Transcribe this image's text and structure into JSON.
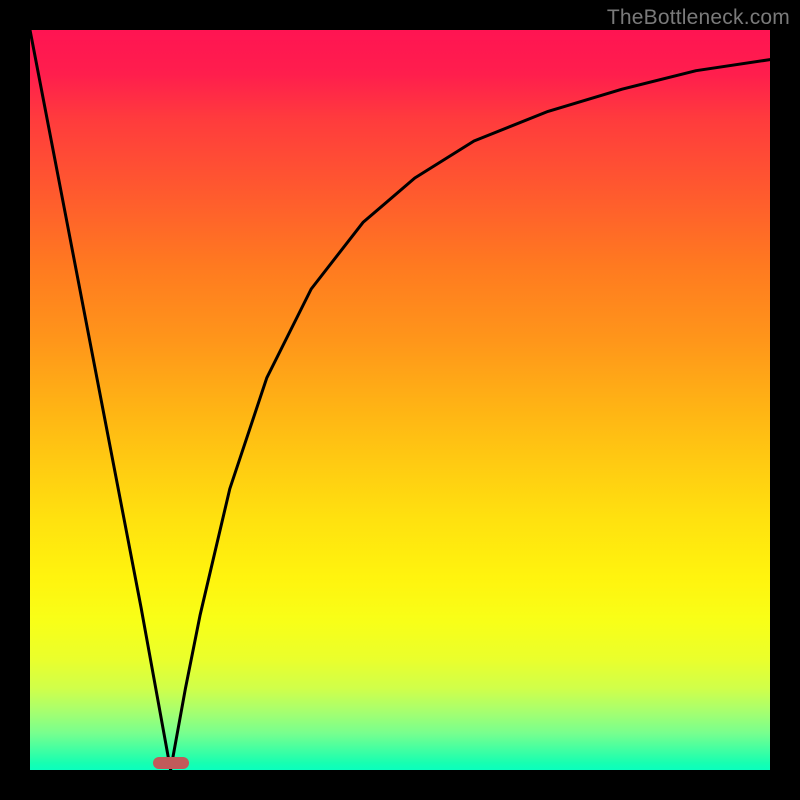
{
  "attribution": "TheBottleneck.com",
  "colors": {
    "page_bg": "#000000",
    "gradient_top": "#ff1452",
    "gradient_bottom": "#0affbe",
    "curve": "#000000",
    "marker": "#c15a5a",
    "attribution_text": "#7a7a7a"
  },
  "chart_data": {
    "type": "line",
    "title": "",
    "xlabel": "",
    "ylabel": "",
    "xlim": [
      0,
      100
    ],
    "ylim": [
      0,
      100
    ],
    "grid": false,
    "note": "x in percent across plot width left→right; y in percent of plot height where 0 = bottom, 100 = top. Curve shows a sharp V-shaped dip to zero near x≈19 then a decelerating rise toward the top-right.",
    "series": [
      {
        "name": "curve",
        "x": [
          0,
          5,
          10,
          15,
          17,
          19,
          21,
          23,
          27,
          32,
          38,
          45,
          52,
          60,
          70,
          80,
          90,
          100
        ],
        "y": [
          100,
          74,
          48,
          22,
          11,
          0,
          11,
          21,
          38,
          53,
          65,
          74,
          80,
          85,
          89,
          92,
          94.5,
          96
        ]
      }
    ],
    "marker": {
      "x": 19,
      "y": 0,
      "shape": "pill"
    }
  }
}
